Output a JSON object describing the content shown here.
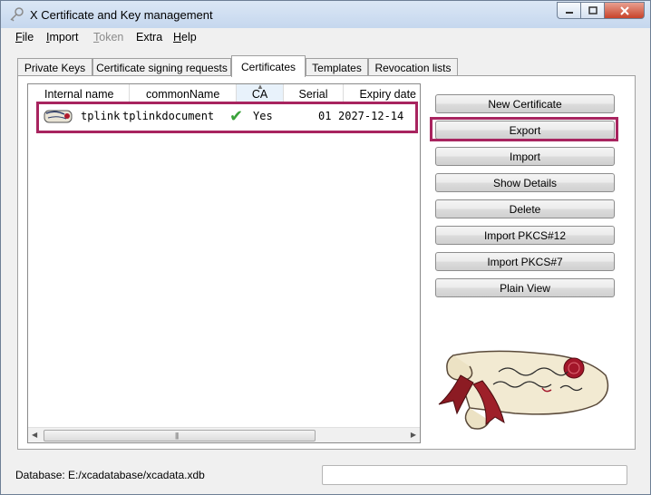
{
  "window": {
    "title": "X Certificate and Key management"
  },
  "menu": {
    "file": {
      "underline": "F",
      "rest": "ile"
    },
    "import": {
      "underline": "I",
      "rest": "mport"
    },
    "token": {
      "underline": "T",
      "rest": "oken"
    },
    "extra": {
      "underline": "",
      "rest": "Extra"
    },
    "help": {
      "underline": "H",
      "rest": "elp"
    }
  },
  "tabs": [
    {
      "label": "Private Keys"
    },
    {
      "label": "Certificate signing requests"
    },
    {
      "label": "Certificates"
    },
    {
      "label": "Templates"
    },
    {
      "label": "Revocation lists"
    }
  ],
  "active_tab": "Certificates",
  "table": {
    "columns": [
      "Internal name",
      "commonName",
      "CA",
      "Serial",
      "Expiry date"
    ],
    "sorted_column": "CA",
    "rows": [
      {
        "internal_name": "tplink",
        "common_name": "tplinkdocument",
        "ca_check": "✔",
        "ca": "Yes",
        "serial": "01",
        "expiry": "2027-12-14"
      }
    ],
    "scroll_grip": "|||"
  },
  "buttons": {
    "new_certificate": "New Certificate",
    "export": "Export",
    "import": "Import",
    "show_details": "Show Details",
    "delete": "Delete",
    "import_pkcs12": "Import PKCS#12",
    "import_pkcs7": "Import PKCS#7",
    "plain_view": "Plain View"
  },
  "status": {
    "database": "Database: E:/xcadatabase/xcadata.xdb"
  },
  "colors": {
    "highlight": "#a8245f",
    "check": "#3aa23a",
    "seal": "#a3162a"
  }
}
